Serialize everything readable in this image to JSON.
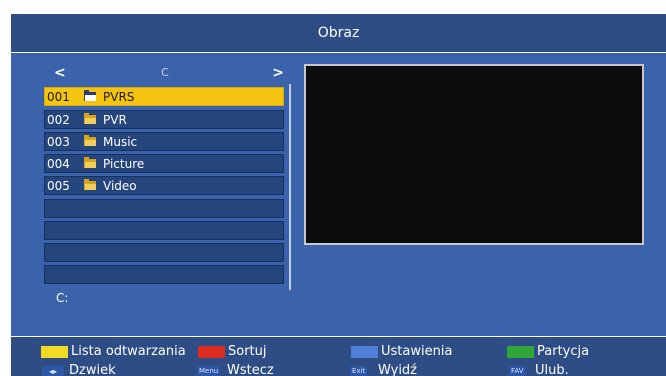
{
  "header": {
    "title": "Obraz"
  },
  "browser": {
    "drive": "C",
    "prev_arrow": "<",
    "next_arrow": ">",
    "items": [
      {
        "number": "001",
        "name": "PVRS",
        "selected": true
      },
      {
        "number": "002",
        "name": "PVR",
        "selected": false
      },
      {
        "number": "003",
        "name": "Music",
        "selected": false
      },
      {
        "number": "004",
        "name": "Picture",
        "selected": false
      },
      {
        "number": "005",
        "name": "Video",
        "selected": false
      }
    ],
    "empty_rows": 4,
    "path": "C:",
    "folder_icon": "folder-icon"
  },
  "footer": {
    "colored": [
      {
        "label": "Lista odtwarzania",
        "color": "#f2dc23"
      },
      {
        "label": "Sortuj",
        "color": "#d92b1e"
      },
      {
        "label": "Ustawienia",
        "color": "#4f7fd6"
      },
      {
        "label": "Partycja",
        "color": "#2fa53a"
      }
    ],
    "keys": [
      {
        "key": "◂▸",
        "label": "Dzwiek"
      },
      {
        "key": "Menu",
        "label": "Wstecz"
      },
      {
        "key": "Exit",
        "label": "Wyidź"
      },
      {
        "key": "FAV",
        "label": "Ulub."
      }
    ]
  },
  "colors": {
    "header_bg": "#2d4d84",
    "panel_bg": "#3b63ab",
    "row_bg": "#25457d",
    "selected_row": "#f5c412",
    "preview_bg": "#0c0c0c"
  }
}
